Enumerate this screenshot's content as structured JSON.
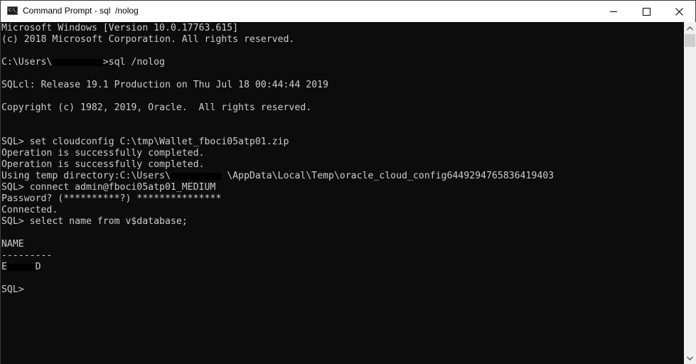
{
  "window": {
    "title": "Command Prompt - sql  /nolog",
    "app_icon_label": "C:\\_",
    "controls": {
      "minimize": "minimize",
      "maximize": "maximize",
      "close": "close"
    }
  },
  "console": {
    "lines": [
      {
        "text": "Microsoft Windows [Version 10.0.17763.615]"
      },
      {
        "text": "(c) 2018 Microsoft Corporation. All rights reserved."
      },
      {
        "text": ""
      },
      {
        "pre": "C:\\Users\\",
        "redacted": "xxxxxxxxx",
        "post": ">sql /nolog"
      },
      {
        "text": ""
      },
      {
        "text": "SQLcl: Release 19.1 Production on Thu Jul 18 00:44:44 2019"
      },
      {
        "text": ""
      },
      {
        "text": "Copyright (c) 1982, 2019, Oracle.  All rights reserved."
      },
      {
        "text": ""
      },
      {
        "text": ""
      },
      {
        "text": "SQL> set cloudconfig C:\\tmp\\Wallet_fboci05atp01.zip"
      },
      {
        "text": "Operation is successfully completed."
      },
      {
        "text": "Operation is successfully completed."
      },
      {
        "pre": "Using temp directory:C:\\Users\\",
        "redacted": "xxxxxxxxx",
        "post": " \\AppData\\Local\\Temp\\oracle_cloud_config6449294765836419403"
      },
      {
        "text": "SQL> connect admin@fboci05atp01_MEDIUM"
      },
      {
        "text": "Password? (**********?) ***************"
      },
      {
        "text": "Connected."
      },
      {
        "text": "SQL> select name from v$database;"
      },
      {
        "text": ""
      },
      {
        "text": "NAME"
      },
      {
        "text": "---------"
      },
      {
        "pre": "E",
        "redacted": "xxxxx",
        "post": "D"
      },
      {
        "text": ""
      },
      {
        "text": "SQL>"
      }
    ]
  },
  "colors": {
    "console_bg": "#0c0c0c",
    "console_fg": "#cccccc",
    "titlebar_bg": "#ffffff",
    "scrollbar_bg": "#f0f0f0",
    "scrollbar_thumb": "#cdcdcd"
  },
  "scrollbar": {
    "up_icon": "chevron-up",
    "down_icon": "chevron-down"
  }
}
